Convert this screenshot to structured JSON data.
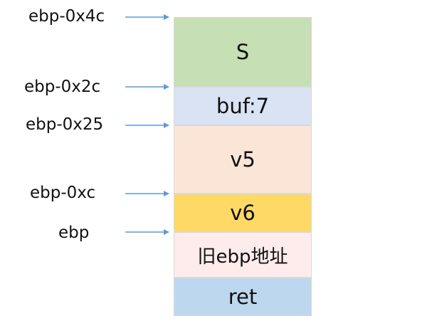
{
  "stack_blocks": [
    {
      "label": "S",
      "color": "#c6dfb4"
    },
    {
      "label": "buf:7",
      "color": "#dae3f3"
    },
    {
      "label": "v5",
      "color": "#fbe5d6"
    },
    {
      "label": "v6",
      "color": "#ffd966"
    },
    {
      "label": "旧ebp地址",
      "color": "#fdeceb"
    },
    {
      "label": "ret",
      "color": "#bdd7ee"
    }
  ],
  "pointers": [
    {
      "label": "ebp-0x4c"
    },
    {
      "label": "ebp-0x2c"
    },
    {
      "label": "ebp-0x25"
    },
    {
      "label": "ebp-0xc"
    },
    {
      "label": "ebp"
    }
  ],
  "arrow_color": "#5b9bd5"
}
